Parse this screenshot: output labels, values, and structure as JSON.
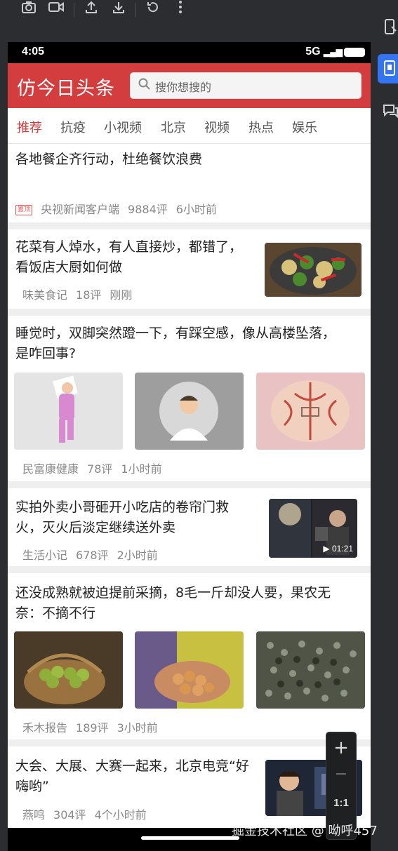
{
  "toolbar": {
    "icons": [
      "camera-icon",
      "video-icon",
      "upload-icon",
      "download-icon",
      "rotate-icon",
      "more-icon"
    ]
  },
  "status": {
    "time": "4:05",
    "network": "5G"
  },
  "app": {
    "title": "仿今日头条",
    "search_placeholder": "搜你想搜的"
  },
  "tabs": [
    "推荐",
    "抗疫",
    "小视频",
    "北京",
    "视频",
    "热点",
    "娱乐"
  ],
  "feed": [
    {
      "title": "各地餐企齐行动，杜绝餐饮浪费",
      "badge": "置顶",
      "source": "央视新闻客户端",
      "comments": "9884评",
      "time": "6小时前"
    },
    {
      "title_l1": "花菜有人焯水，有人直接炒，都错了，",
      "title_l2": "看饭店大厨如何做",
      "source": "味美食记",
      "comments": "18评",
      "time": "刚刚"
    },
    {
      "title_l1": "睡觉时，双脚突然蹬一下，有踩空感，像从高楼坠落，",
      "title_l2": "是咋回事?",
      "source": "民富康健康",
      "comments": "78评",
      "time": "1小时前"
    },
    {
      "title_l1": "实拍外卖小哥砸开小吃店的卷帘门救",
      "title_l2": "火，灭火后淡定继续送外卖",
      "source": "生活小记",
      "comments": "678评",
      "time": "2小时前",
      "duration": "01:21"
    },
    {
      "title_l1": "还没成熟就被迫提前采摘，8毛一斤却没人要，果农无",
      "title_l2": "奈：不摘不行",
      "source": "禾木报告",
      "comments": "189评",
      "time": "3小时前"
    },
    {
      "title_l1": "大会、大展、大赛一起来，北京电竞“好",
      "title_l2": "嗨哟”",
      "source": "燕鸣",
      "comments": "304评",
      "time": "4个小时前"
    }
  ],
  "zoom": {
    "plus": "+",
    "minus": "−",
    "ratio": "1:1"
  },
  "watermark": "掘金技术社区 @ 呦呼457",
  "colors": {
    "brand": "#d43d3d",
    "gap": "#efefef"
  }
}
